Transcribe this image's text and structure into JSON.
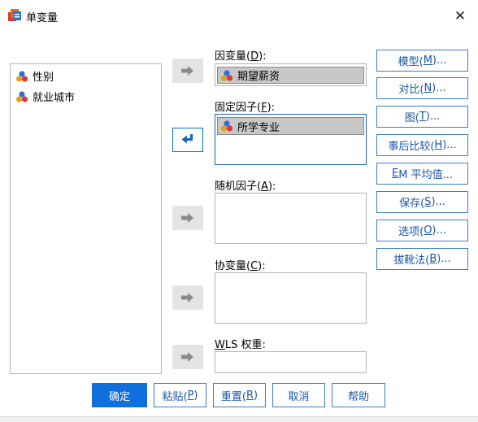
{
  "window": {
    "title": "单变量",
    "close_glyph": "✕"
  },
  "variable_list": {
    "items": [
      "性别",
      "就业城市"
    ]
  },
  "dependent": {
    "label_pre": "因变量(",
    "label_key": "D",
    "label_post": "):",
    "value": "期望薪资"
  },
  "fixed": {
    "label_pre": "固定因子(",
    "label_key": "F",
    "label_post": "):",
    "items": [
      "所学专业"
    ]
  },
  "random": {
    "label_pre": "随机因子(",
    "label_key": "A",
    "label_post": "):"
  },
  "covariate": {
    "label_pre": "协变量(",
    "label_key": "C",
    "label_post": "):"
  },
  "wls": {
    "label_key": "W",
    "label_post": "LS 权重:"
  },
  "side_buttons": {
    "model": {
      "pre": "模型(",
      "key": "M",
      "post": ")..."
    },
    "contrast": {
      "pre": "对比(",
      "key": "N",
      "post": ")..."
    },
    "plots": {
      "pre": "图(",
      "key": "T",
      "post": ")..."
    },
    "posthoc": {
      "pre": "事后比较(",
      "key": "H",
      "post": ")..."
    },
    "em": {
      "key": "E",
      "post": "M 平均值..."
    },
    "save": {
      "pre": "保存(",
      "key": "S",
      "post": ")..."
    },
    "options": {
      "pre": "选项(",
      "key": "O",
      "post": ")..."
    },
    "bootstrap": {
      "pre": "拔靴法(",
      "key": "B",
      "post": ")..."
    }
  },
  "bottom_buttons": {
    "ok": "确定",
    "paste": {
      "pre": "粘贴(",
      "key": "P",
      "post": ")"
    },
    "reset": {
      "pre": "重置(",
      "key": "R",
      "post": ")"
    },
    "cancel": "取消",
    "help": "帮助"
  },
  "colors": {
    "accent": "#0f6fdc",
    "button_border": "#3b7fc4",
    "button_text": "#1a56a8",
    "selected_bg": "#c8c8c8",
    "arrow_inactive": "#e4e4e4"
  },
  "icons": {
    "nominal": "nominal-variable-icon",
    "scale": "scale-variable-icon",
    "arrow": "arrow-right-icon",
    "back": "arrow-left-icon"
  }
}
